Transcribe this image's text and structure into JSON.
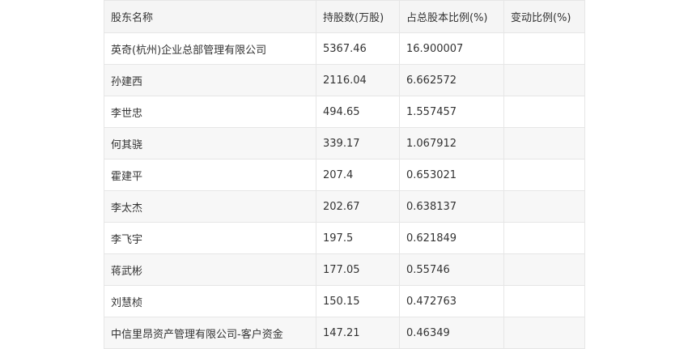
{
  "table": {
    "headers": [
      "股东名称",
      "持股数(万股)",
      "占总股本比例(%)",
      "变动比例(%)"
    ],
    "rows": [
      {
        "name": "英奇(杭州)企业总部管理有限公司",
        "shares": "5367.46",
        "ratio": "16.900007",
        "change": ""
      },
      {
        "name": "孙建西",
        "shares": "2116.04",
        "ratio": "6.662572",
        "change": ""
      },
      {
        "name": "李世忠",
        "shares": "494.65",
        "ratio": "1.557457",
        "change": ""
      },
      {
        "name": "何其骁",
        "shares": "339.17",
        "ratio": "1.067912",
        "change": ""
      },
      {
        "name": "霍建平",
        "shares": "207.4",
        "ratio": "0.653021",
        "change": ""
      },
      {
        "name": "李太杰",
        "shares": "202.67",
        "ratio": "0.638137",
        "change": ""
      },
      {
        "name": "李飞宇",
        "shares": "197.5",
        "ratio": "0.621849",
        "change": ""
      },
      {
        "name": "蒋武彬",
        "shares": "177.05",
        "ratio": "0.55746",
        "change": ""
      },
      {
        "name": "刘慧桢",
        "shares": "150.15",
        "ratio": "0.472763",
        "change": ""
      },
      {
        "name": "中信里昂资产管理有限公司-客户资金",
        "shares": "147.21",
        "ratio": "0.46349",
        "change": ""
      }
    ]
  }
}
